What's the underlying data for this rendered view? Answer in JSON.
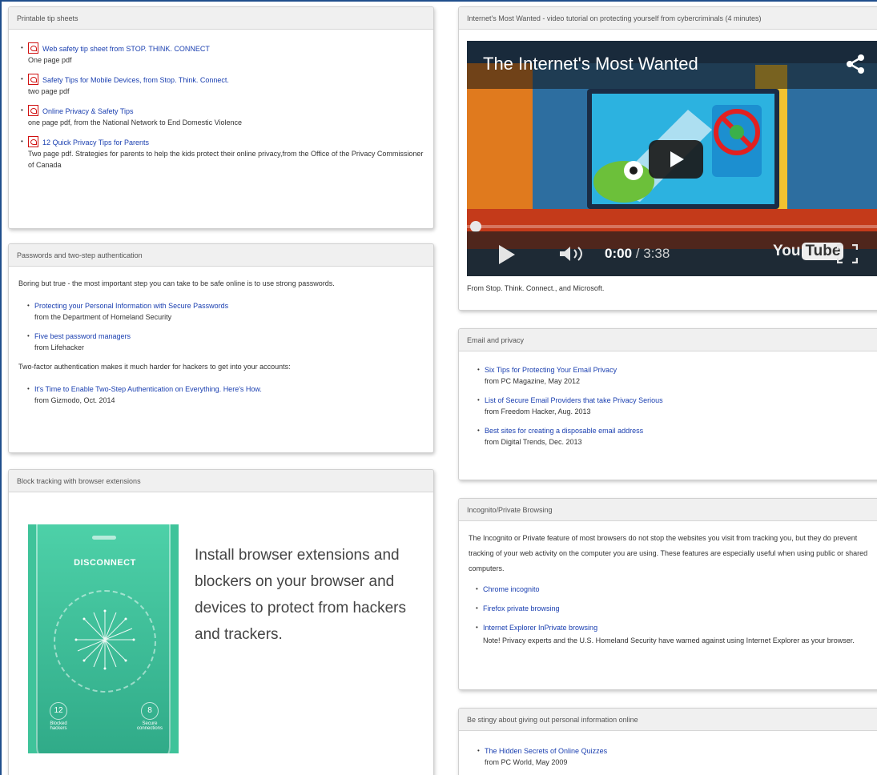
{
  "printable": {
    "header": "Printable tip sheets",
    "items": [
      {
        "link": "Web safety tip sheet from STOP. THINK. CONNECT",
        "note": "One page pdf"
      },
      {
        "link": "Safety Tips for Mobile Devices, from Stop. Think. Connect.",
        "note": "two page pdf"
      },
      {
        "link": "Online Privacy & Safety Tips",
        "note": "one page pdf, from the National Network to End Domestic Violence"
      },
      {
        "link": "12 Quick Privacy Tips for Parents",
        "note": "Two page pdf. Strategies for parents to help the kids protect their online privacy,from the Office of the Privacy Commissioner of Canada"
      }
    ]
  },
  "passwords": {
    "header": "Passwords and two-step authentication",
    "intro": "Boring but true - the most important step you can take to be safe online is to use strong passwords.",
    "items": [
      {
        "link": "Protecting your Personal Information with Secure Passwords",
        "note": "from the Department of Homeland Security"
      },
      {
        "link": "Five best password managers",
        "note": "from Lifehacker"
      }
    ],
    "intro2": "Two-factor authentication makes it much harder for hackers to get into your accounts:",
    "items2": [
      {
        "link": "It's Time to Enable Two-Step Authentication on Everything. Here's How.",
        "note": "from Gizmodo, Oct. 2014"
      }
    ]
  },
  "block": {
    "header": "Block tracking with browser extensions",
    "phone_label": "DISCONNECT",
    "stat_left_num": "12",
    "stat_left_label": "Blocked hackers",
    "stat_right_num": "8",
    "stat_right_label": "Secure connections",
    "text": "Install browser extensions and blockers on your browser and devices to protect from hackers and trackers."
  },
  "video_panel": {
    "header": "Internet's Most Wanted - video tutorial on protecting yourself from cybercriminals (4 minutes)",
    "video_title": "The Internet's Most Wanted",
    "time_current": "0:00",
    "time_total": "/ 3:38",
    "yt_you": "You",
    "yt_tube": "Tube",
    "caption": "From Stop. Think. Connect., and Microsoft."
  },
  "email": {
    "header": "Email and privacy",
    "items": [
      {
        "link": "Six Tips for Protecting Your Email Privacy",
        "note": "from PC Magazine, May 2012"
      },
      {
        "link": "List of Secure Email Providers that take Privacy Serious",
        "note": "from Freedom Hacker, Aug. 2013"
      },
      {
        "link": "Best sites for creating a disposable email address",
        "note": "from Digital Trends, Dec. 2013"
      }
    ]
  },
  "incognito": {
    "header": "Incognito/Private Browsing",
    "intro": "The Incognito or Private feature of most browsers do not stop the websites you visit from tracking you, but they do prevent tracking of your web activity on the computer you are using.  These features are especially useful when using public or shared computers.",
    "items": [
      {
        "link": "Chrome incognito",
        "note": ""
      },
      {
        "link": "Firefox private browsing",
        "note": ""
      },
      {
        "link": "Internet Explorer InPrivate browsing",
        "note": "Note! Privacy experts and the U.S. Homeland Security have warned against using Internet Explorer as your browser."
      }
    ]
  },
  "stingy": {
    "header": "Be stingy about giving out personal information online",
    "items": [
      {
        "link": "The Hidden Secrets of Online Quizzes",
        "note": "from PC World, May 2009"
      }
    ]
  },
  "colors": {
    "link": "#1a3fb0",
    "pdf_red": "#d01010",
    "frame_blue": "#1f4e8c",
    "header_bg": "#f0f0f0"
  }
}
